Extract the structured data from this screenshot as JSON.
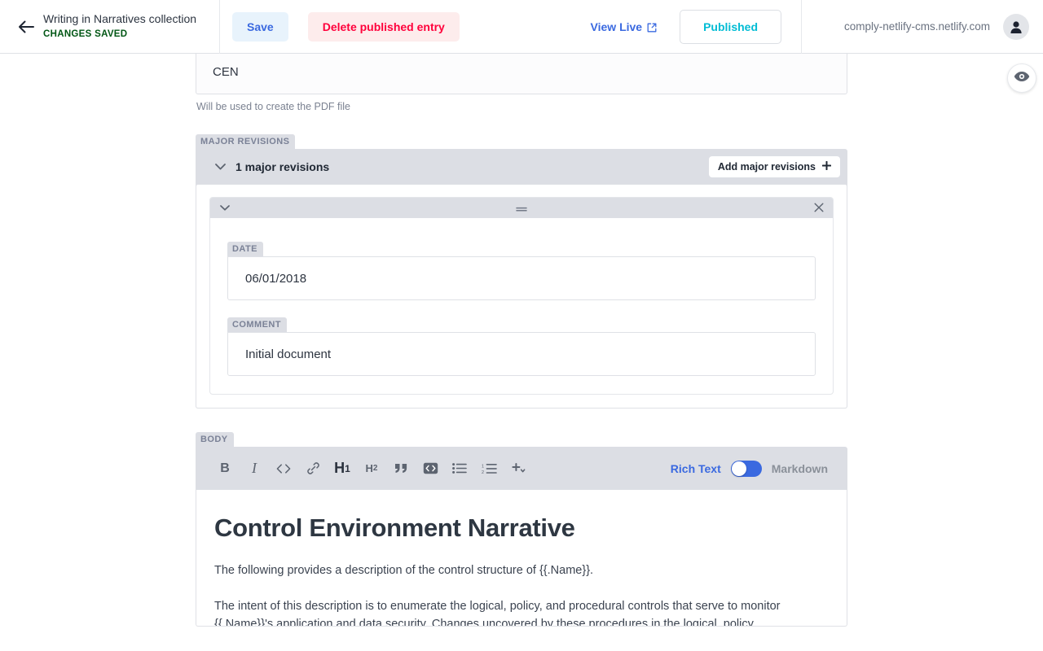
{
  "topbar": {
    "back_icon": "back-arrow-icon",
    "collection_title": "Writing in Narratives collection",
    "status": "CHANGES SAVED",
    "save_label": "Save",
    "delete_label": "Delete published entry",
    "view_live_label": "View Live",
    "external_link_icon": "external-link-icon",
    "publish_status_label": "Published",
    "site_url": "comply-netlify-cms.netlify.com",
    "avatar_icon": "user-avatar-icon"
  },
  "preview_toggle": {
    "icon": "eye-icon"
  },
  "title_field": {
    "value": "CEN",
    "hint": "Will be used to create the PDF file"
  },
  "major_revisions": {
    "label": "MAJOR REVISIONS",
    "collapse_icon": "chevron-down-icon",
    "summary": "1 major revisions",
    "add_label": "Add major revisions",
    "add_icon": "plus-icon",
    "item": {
      "collapse_icon": "chevron-down-icon",
      "drag_icon": "drag-handle-icon",
      "remove_icon": "close-icon",
      "fields": [
        {
          "label": "DATE",
          "value": "06/01/2018"
        },
        {
          "label": "COMMENT",
          "value": "Initial document"
        }
      ]
    }
  },
  "body_widget": {
    "label": "BODY",
    "toolbar": [
      {
        "name": "bold-icon",
        "glyph": "B"
      },
      {
        "name": "italic-icon",
        "glyph": "I"
      },
      {
        "name": "code-icon",
        "glyph": "<>"
      },
      {
        "name": "link-icon",
        "glyph": "ὑ7"
      },
      {
        "name": "heading-1-icon",
        "glyph": "H1"
      },
      {
        "name": "heading-2-icon",
        "glyph": "H2"
      },
      {
        "name": "quote-icon",
        "glyph": "”"
      },
      {
        "name": "code-block-icon",
        "glyph": "<>"
      },
      {
        "name": "bulleted-list-icon",
        "glyph": "☰"
      },
      {
        "name": "numbered-list-icon",
        "glyph": "☰"
      },
      {
        "name": "add-component-icon",
        "glyph": "+"
      }
    ],
    "mode": {
      "rich_text_label": "Rich Text",
      "markdown_label": "Markdown",
      "active": "Rich Text",
      "accent_color": "#3a69e0"
    },
    "document": {
      "heading": "Control Environment Narrative",
      "paragraph_1": "The following provides a description of the control structure of {{.Name}}.",
      "paragraph_2": "The intent of this description is to enumerate the logical, policy, and procedural controls that serve to monitor {{.Name}}'s application and data security. Changes uncovered by these procedures in the logical, policy,"
    }
  }
}
